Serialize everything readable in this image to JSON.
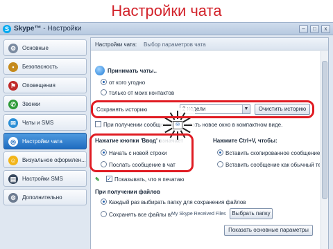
{
  "banner": {
    "title": "Настройки чата"
  },
  "window": {
    "app_name": "Skype™",
    "separator": " - ",
    "title": "Настройки",
    "buttons": [
      "–",
      "□",
      "x"
    ]
  },
  "sidebar": {
    "items": [
      {
        "label": "Основные",
        "icon": "gear-icon",
        "color": "#7a8aa0",
        "glyph": "⚙"
      },
      {
        "label": "Безопасность",
        "icon": "lock-icon",
        "color": "#c58a1c",
        "glyph": "🔒"
      },
      {
        "label": "Оповещения",
        "icon": "flag-icon",
        "color": "#c02a2a",
        "glyph": "⚑"
      },
      {
        "label": "Звонки",
        "icon": "phone-icon",
        "color": "#2f9b3a",
        "glyph": "✆"
      },
      {
        "label": "Чаты и SMS",
        "icon": "chat-icon",
        "color": "#2c8fd6",
        "glyph": "✉"
      },
      {
        "label": "Настройки чата",
        "icon": "chat-settings-icon",
        "color": "#ffffff",
        "glyph": "◎",
        "active": true
      },
      {
        "label": "Визуальное оформлен...",
        "icon": "smiley-icon",
        "color": "#f2b51a",
        "glyph": "☺"
      },
      {
        "label": "Настройки SMS",
        "icon": "sms-icon",
        "color": "#3a4a5f",
        "glyph": "▤"
      },
      {
        "label": "Дополнительно",
        "icon": "advanced-gear-icon",
        "color": "#6c7b90",
        "glyph": "⚙"
      }
    ]
  },
  "panel": {
    "header_title": "Настройки чата:",
    "header_subtitle": "Выбор параметров чата",
    "accept_chats": {
      "label": "Принимать чаты..",
      "options": [
        "от кого угодно",
        "только от моих контактов"
      ],
      "selected": 0
    },
    "history": {
      "label": "Сохранять историю",
      "select_value": "2 недели",
      "clear_button": "Очистить историю"
    },
    "new_message_checkbox": {
      "label": "При получении сообщения открывать новое окно в компактном виде.",
      "checked": false
    },
    "enter_key": {
      "label": "Нажатие кнопки 'Ввод' означает",
      "options": [
        "Начать с новой строки",
        "Послать сообщение в чат"
      ],
      "selected": 0
    },
    "ctrl_v": {
      "label": "Нажмите Ctrl+V, чтобы:",
      "options": [
        "Вставить скопированное сообщение ка",
        "Вставить сообщение как обычный текс"
      ],
      "selected": 0
    },
    "typing_checkbox": {
      "label": "Показывать, что я печатаю",
      "checked": true
    },
    "file_receive": {
      "label": "При получении файлов",
      "options": [
        "Каждый раз выбирать папку для сохранения файлов",
        "Сохранять все файлы в:"
      ],
      "selected": 0,
      "folder_path": "My Skype Received Files",
      "choose_folder_button": "Выбрать папку"
    },
    "show_main_settings_button": "Показать основные параметры"
  },
  "spinner": {
    "core_text": "✉"
  }
}
